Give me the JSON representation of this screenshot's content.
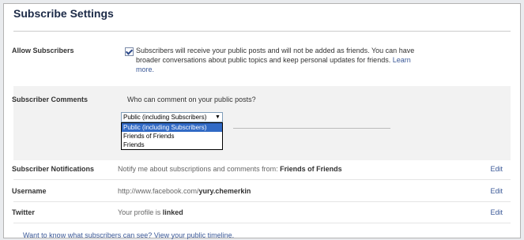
{
  "page_title": "Subscribe Settings",
  "allow": {
    "label": "Allow Subscribers",
    "checked": true,
    "description": "Subscribers will receive your public posts and will not be added as friends. You can have broader conversations about public topics and keep personal updates for friends.",
    "learn_more": "Learn more."
  },
  "comments": {
    "label": "Subscriber Comments",
    "question": "Who can comment on your public posts?",
    "selected": "Public (including Subscribers)",
    "options": [
      "Public (including Subscribers)",
      "Friends of Friends",
      "Friends"
    ]
  },
  "notifications": {
    "label": "Subscriber Notifications",
    "text": "Notify me about subscriptions and comments from: ",
    "value": "Friends of Friends",
    "edit": "Edit"
  },
  "username": {
    "label": "Username",
    "prefix": "http://www.facebook.com/",
    "value": "yury.chemerkin",
    "edit": "Edit"
  },
  "twitter": {
    "label": "Twitter",
    "prefix": "Your profile is ",
    "value": "linked",
    "edit": "Edit"
  },
  "footer": {
    "text": "Want to know what subscribers can see? View your public timeline."
  }
}
